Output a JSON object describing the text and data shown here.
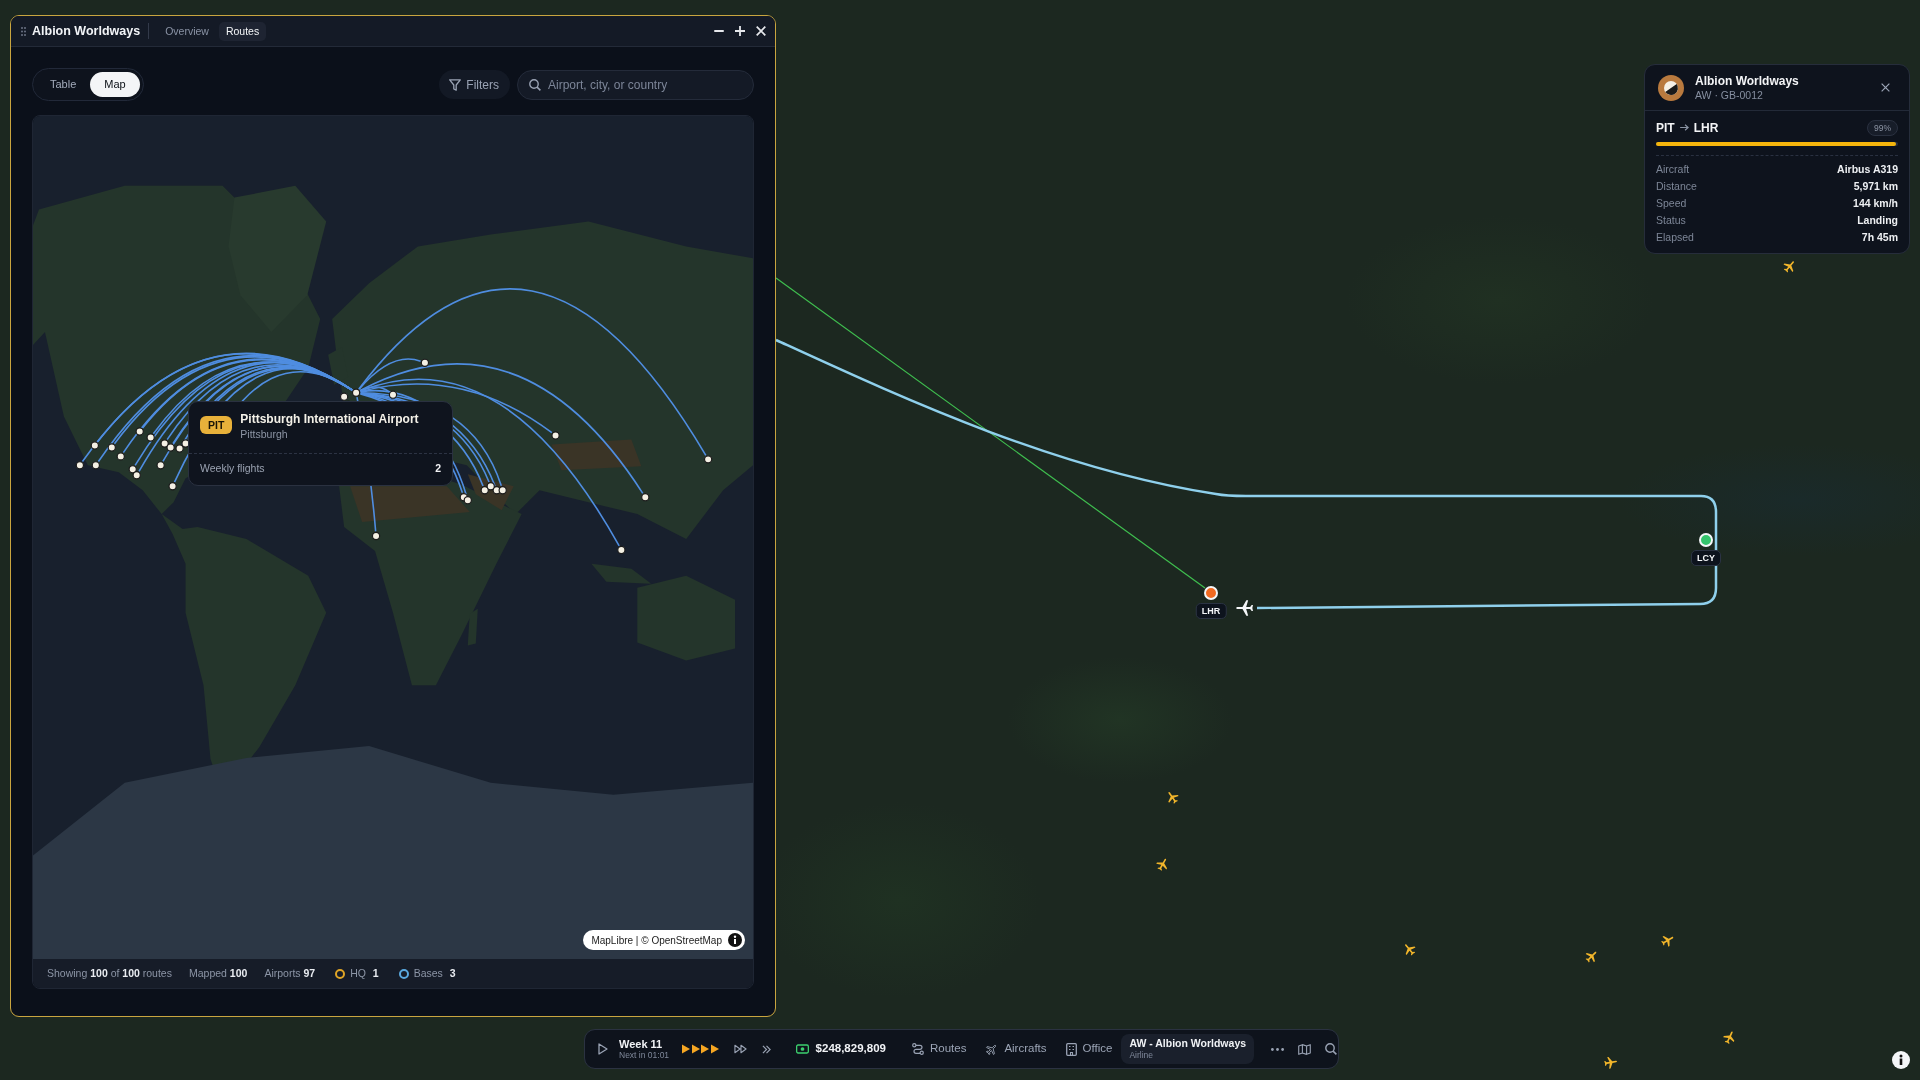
{
  "routes_window": {
    "title": "Albion Worldways",
    "tabs": [
      {
        "label": "Overview",
        "selected": false
      },
      {
        "label": "Routes",
        "selected": true
      }
    ],
    "view_toggle": [
      {
        "label": "Table",
        "selected": false
      },
      {
        "label": "Map",
        "selected": true
      }
    ],
    "filters_button": "Filters",
    "search": {
      "placeholder": "Airport, city, or country"
    },
    "map_tooltip": {
      "code": "PIT",
      "name": "Pittsburgh International Airport",
      "city": "Pittsburgh",
      "stat_label": "Weekly flights",
      "stat_value": "2"
    },
    "attribution": "MapLibre | © OpenStreetMap",
    "footer": [
      {
        "kind": "stat",
        "text": "Showing **100** of **100** routes"
      },
      {
        "kind": "stat",
        "text": "Mapped **100**"
      },
      {
        "kind": "stat",
        "text": "Airports **97**"
      },
      {
        "kind": "legend",
        "text": "HQ **1**",
        "color": "#e0a526"
      },
      {
        "kind": "legend",
        "text": "Bases **3**",
        "color": "#5aa9e0"
      }
    ]
  },
  "flight_map": {
    "airports": [
      {
        "code": "LHR",
        "color": "#f26a21"
      },
      {
        "code": "LCY",
        "color": "#34c46c"
      }
    ],
    "aircraft": [
      {
        "selected": true
      },
      {
        "selected": false
      },
      {
        "selected": false
      },
      {
        "selected": false
      },
      {
        "selected": false
      },
      {
        "selected": false
      },
      {
        "selected": false
      },
      {
        "selected": false
      },
      {
        "selected": false
      }
    ]
  },
  "flight_card": {
    "airline": "Albion Worldways",
    "registration": "AW · GB-0012",
    "origin": "PIT",
    "destination": "LHR",
    "progress": {
      "label": "99%",
      "level": 0.99
    },
    "details": [
      {
        "label": "Aircraft",
        "value": "Airbus A319"
      },
      {
        "label": "Distance",
        "value": "5,971 km"
      },
      {
        "label": "Speed",
        "value": "144 km/h"
      },
      {
        "label": "Status",
        "value": "Landing"
      },
      {
        "label": "Elapsed",
        "value": "7h 45m"
      }
    ]
  },
  "toolbar": {
    "week": "Week 11",
    "next_turn": "Next in 01:01",
    "balance": "$248,829,809",
    "links": [
      {
        "label": "Routes"
      },
      {
        "label": "Aircrafts"
      },
      {
        "label": "Office"
      }
    ],
    "airline": {
      "name": "AW - Albion Worldways",
      "type": "Airline"
    }
  }
}
